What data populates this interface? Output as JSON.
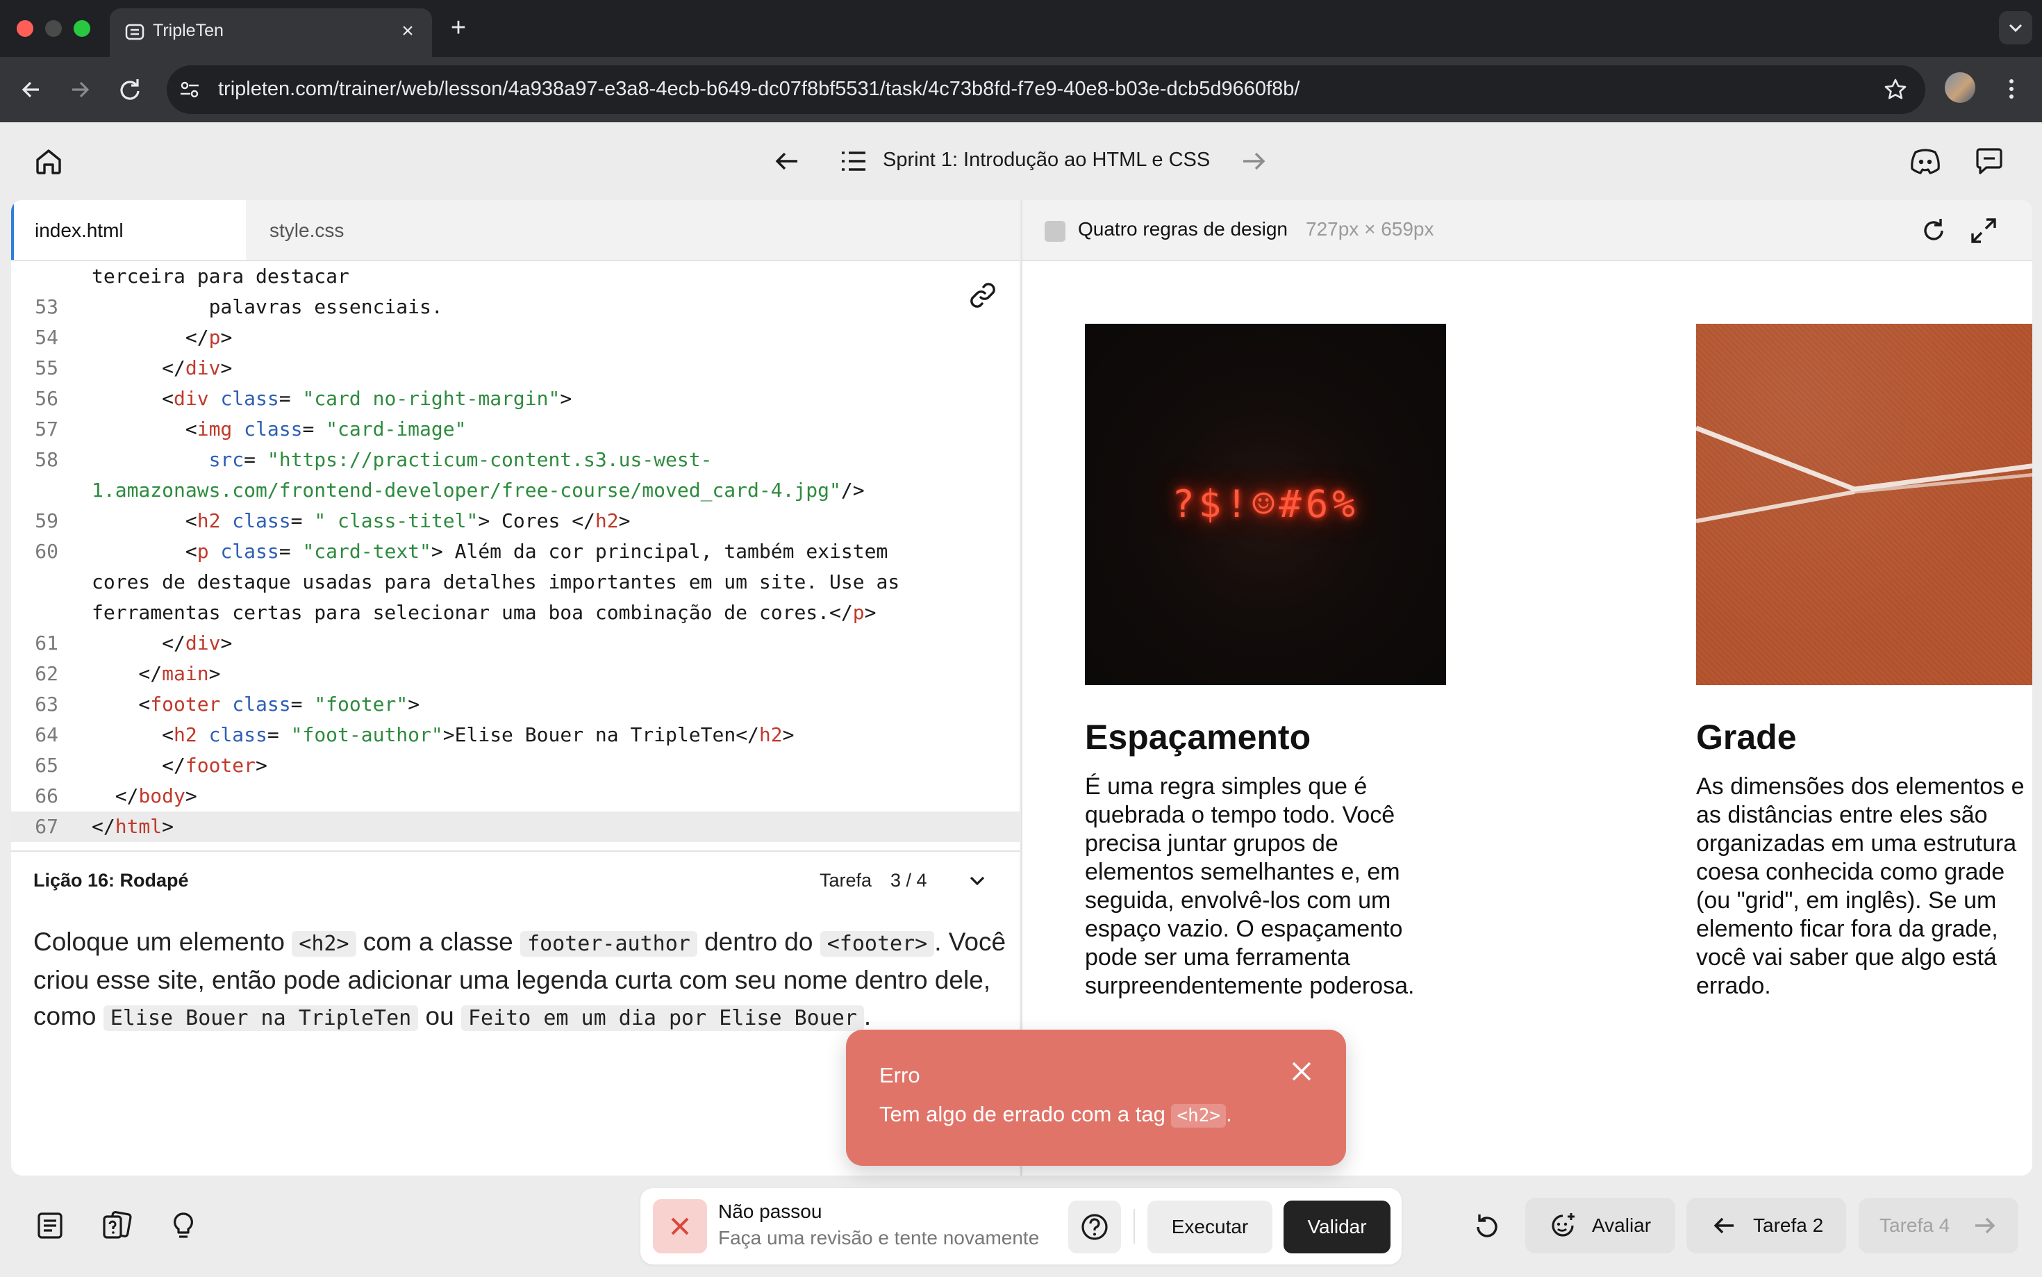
{
  "browser": {
    "tab_title": "TripleTen",
    "url": "tripleten.com/trainer/web/lesson/4a938a97-e3a8-4ecb-b649-dc07f8bf5531/task/4c73b8fd-f7e9-40e8-b03e-dcb5d9660f8b/"
  },
  "header": {
    "sprint_title": "Sprint 1: Introdução ao HTML e CSS"
  },
  "editor": {
    "tabs": [
      "index.html",
      "style.css"
    ],
    "active_tab": "index.html",
    "code_lines": [
      {
        "num": "",
        "html": "terceira para destacar"
      },
      {
        "num": "53",
        "html": "          palavras essenciais."
      },
      {
        "num": "54",
        "html": "        &lt;/<span class=\"tg\">p</span>&gt;"
      },
      {
        "num": "55",
        "html": "      &lt;/<span class=\"tg\">div</span>&gt;"
      },
      {
        "num": "56",
        "html": "      &lt;<span class=\"tg\">div</span> <span class=\"at\">class</span>= <span class=\"sv\">\"card no-right-margin\"</span>&gt;"
      },
      {
        "num": "57",
        "html": "        &lt;<span class=\"tg\">img</span> <span class=\"at\">class</span>= <span class=\"sv\">\"card-image\"</span>"
      },
      {
        "num": "58",
        "html": "          <span class=\"at\">src</span>= <span class=\"sv\">\"https://practicum-content.s3.us-west-</span>"
      },
      {
        "num": "",
        "html": "<span class=\"sv\">1.amazonaws.com/frontend-developer/free-course/moved_card-4.jpg\"</span>/&gt;"
      },
      {
        "num": "59",
        "html": "        &lt;<span class=\"tg\">h2</span> <span class=\"at\">class</span>= <span class=\"sv\">\" class-titel\"</span>&gt; Cores &lt;/<span class=\"tg\">h2</span>&gt;"
      },
      {
        "num": "60",
        "html": "        &lt;<span class=\"tg\">p</span> <span class=\"at\">class</span>= <span class=\"sv\">\"card-text\"</span>&gt; Além da cor principal, também existem"
      },
      {
        "num": "",
        "html": "cores de destaque usadas para detalhes importantes em um site. Use as"
      },
      {
        "num": "",
        "html": "ferramentas certas para selecionar uma boa combinação de cores.&lt;/<span class=\"tg\">p</span>&gt;"
      },
      {
        "num": "61",
        "html": "      &lt;/<span class=\"tg\">div</span>&gt;"
      },
      {
        "num": "62",
        "html": "    &lt;/<span class=\"tg\">main</span>&gt;"
      },
      {
        "num": "63",
        "html": "    &lt;<span class=\"tg\">footer</span> <span class=\"at\">class</span>= <span class=\"sv\">\"footer\"</span>&gt;"
      },
      {
        "num": "64",
        "html": "      &lt;<span class=\"tg\">h2</span> <span class=\"at\">class</span>= <span class=\"sv\">\"foot-author\"</span>&gt;Elise Bouer na TripleTen&lt;/<span class=\"tg\">h2</span>&gt;"
      },
      {
        "num": "65",
        "html": "      &lt;/<span class=\"tg\">footer</span>&gt;"
      },
      {
        "num": "66",
        "html": "  &lt;/<span class=\"tg\">body</span>&gt;"
      },
      {
        "num": "67",
        "html": "&lt;/<span class=\"tg\">html</span>&gt;"
      }
    ],
    "highlighted_line": "67"
  },
  "lesson": {
    "title": "Lição 16: Rodapé",
    "task_label": "Tarefa",
    "task_count": "3 / 4",
    "instructions": {
      "t1": "Coloque um elemento ",
      "c1": "<h2>",
      "t2": " com a classe ",
      "c2": "footer-author",
      "t3": " dentro do ",
      "c3": " <footer>",
      "t4": ". Você criou esse site, então pode adicionar uma legenda curta com seu nome dentro dele, como ",
      "c4": "Elise Bouer na TripleTen",
      "t5": " ou ",
      "c5": "Feito em um dia por Elise Bouer",
      "t6": "."
    }
  },
  "preview": {
    "title": "Quatro regras de design",
    "dimensions": "727px × 659px",
    "neon_text": "?$!☺#6%",
    "cards": [
      {
        "heading": "Espaçamento",
        "text": "É uma regra simples que é\nquebrada o tempo todo. Você\nprecisa juntar grupos de\nelementos semelhantes e, em\nseguida, envolvê-los com um\nespaço vazio. O espaçamento\npode ser uma ferramenta\nsurpreendentemente poderosa."
      },
      {
        "heading": "Grade",
        "text": "As dimensões dos elementos e\nas distâncias entre eles são\norganizadas em uma estrutura\ncoesa conhecida como grade\n(ou \"grid\", em inglês). Se um\nelemento ficar fora da grade,\nvocê vai saber que algo está\nerrado."
      }
    ]
  },
  "toast": {
    "title": "Erro",
    "message": "Tem algo de errado com a tag ",
    "code": "<h2>",
    "message_end": "."
  },
  "status": {
    "title": "Não passou",
    "subtitle": "Faça uma revisão e tente novamente",
    "run_label": "Executar",
    "validate_label": "Validar"
  },
  "actions": {
    "evaluate_label": "Avaliar",
    "prev_task_label": "Tarefa 2",
    "next_task_label": "Tarefa 4"
  },
  "colors": {
    "accent_tab": "#2f7de1",
    "error_toast": "#e17469",
    "validate_button": "#232323"
  }
}
